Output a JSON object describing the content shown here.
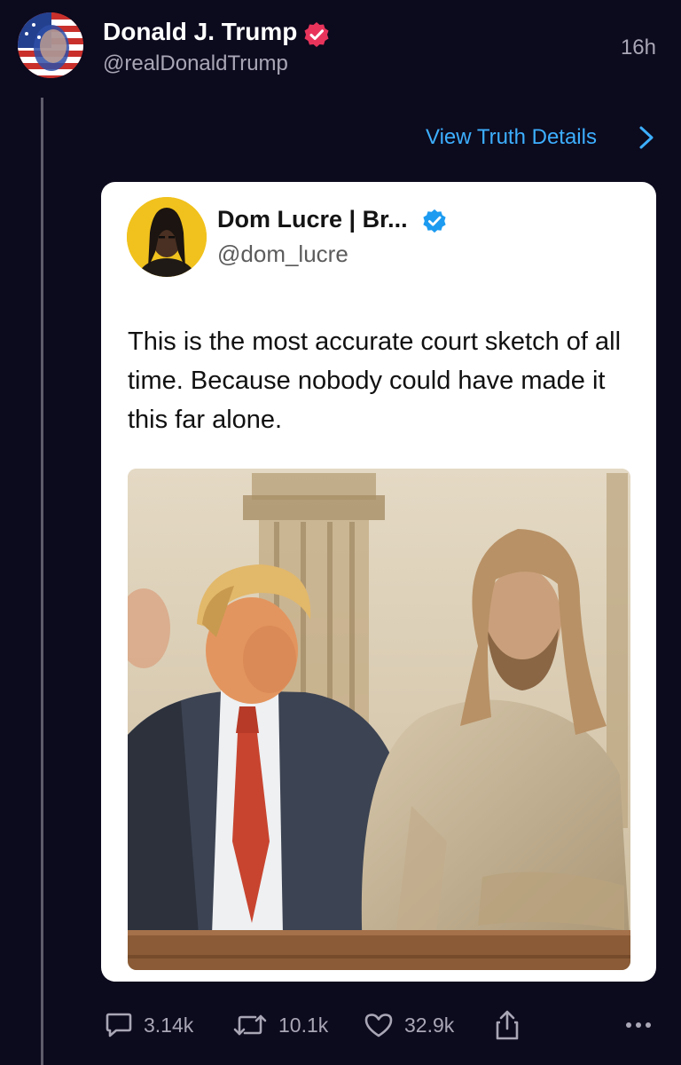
{
  "post": {
    "author_name": "Donald J. Trump",
    "author_handle": "@realDonaldTrump",
    "time_ago": "16h",
    "view_details_label": "View Truth Details"
  },
  "embed": {
    "author_name": "Dom Lucre | Br...",
    "author_handle": "@dom_lucre",
    "text": "This is the most accurate court sketch of all time. Because nobody could have made it this far alone."
  },
  "actions": {
    "reply_count": "3.14k",
    "retruth_count": "10.1k",
    "like_count": "32.9k"
  },
  "icons": {
    "verified_post": "verified-check-icon",
    "verified_embed": "verified-check-icon",
    "chevron": "chevron-right-icon",
    "reply": "speech-bubble-icon",
    "retruth": "repost-arrows-icon",
    "like": "heart-icon",
    "share": "share-icon",
    "more": "more-dots-icon"
  },
  "colors": {
    "background": "#0c0a1d",
    "link": "#3dafff",
    "verified_pink": "#e8345b",
    "verified_blue": "#1d9bf0",
    "muted_text": "#a9a7b6"
  }
}
